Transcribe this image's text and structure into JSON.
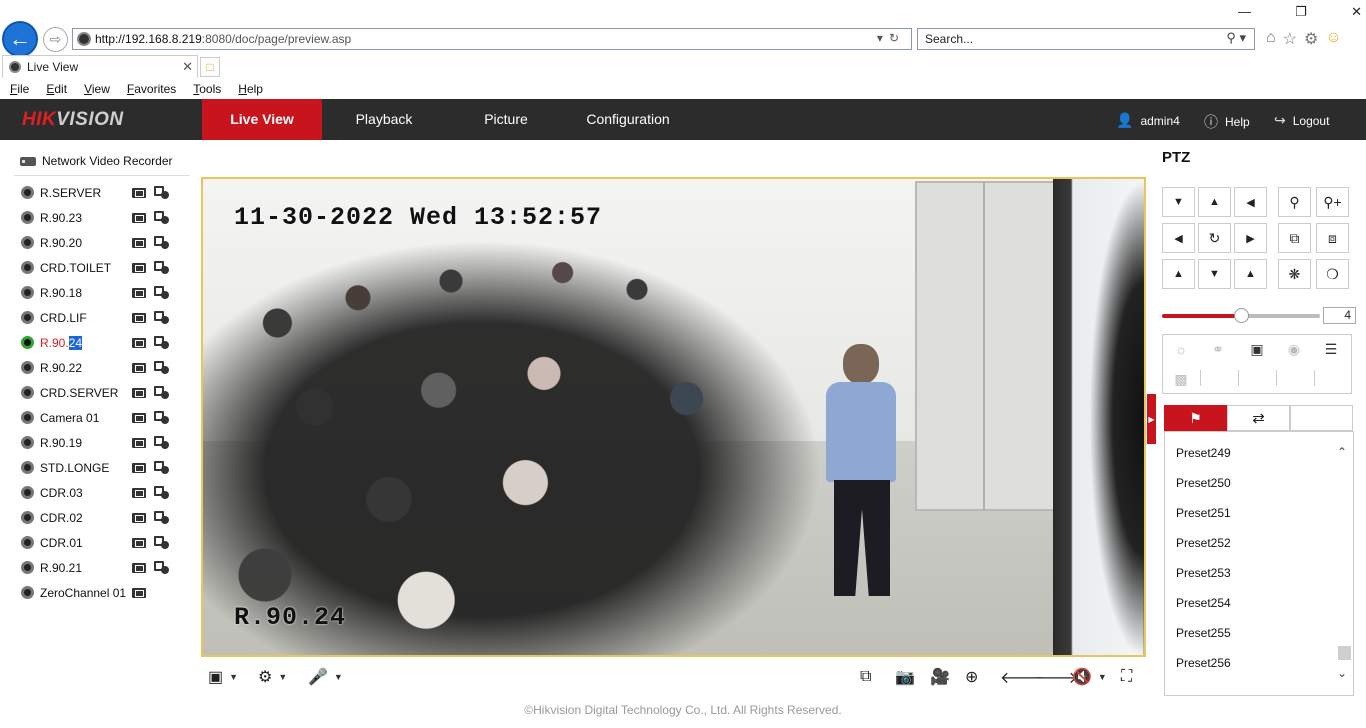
{
  "browser": {
    "url_dark": "http://192.168.8.219",
    "url_rest": ":8080/doc/page/preview.asp",
    "search_placeholder": "Search...",
    "tab_title": "Live View",
    "menu": [
      "File",
      "Edit",
      "View",
      "Favorites",
      "Tools",
      "Help"
    ]
  },
  "app": {
    "logo_hik": "HIK",
    "logo_vision": "VISION",
    "tabs": [
      "Live View",
      "Playback",
      "Picture",
      "Configuration"
    ],
    "user": "admin4",
    "help": "Help",
    "logout": "Logout",
    "accent": "#c8151d"
  },
  "tree": {
    "root": "Network Video Recorder",
    "cameras": [
      {
        "name": "R.SERVER"
      },
      {
        "name": "R.90.23"
      },
      {
        "name": "R.90.20"
      },
      {
        "name": "CRD.TOILET"
      },
      {
        "name": "R.90.18"
      },
      {
        "name": "CRD.LIF"
      },
      {
        "name_red": "R.90.",
        "name_sel": "24",
        "active": true
      },
      {
        "name": "R.90.22"
      },
      {
        "name": "CRD.SERVER"
      },
      {
        "name": "Camera 01"
      },
      {
        "name": "R.90.19"
      },
      {
        "name": "STD.LONGE"
      },
      {
        "name": "CDR.03"
      },
      {
        "name": "CDR.02"
      },
      {
        "name": "CDR.01"
      },
      {
        "name": "R.90.21"
      },
      {
        "name": "ZeroChannel 01"
      }
    ]
  },
  "video": {
    "timestamp": "11-30-2022 Wed 13:52:57",
    "label": "R.90.24"
  },
  "ptz": {
    "title": "PTZ",
    "speed": "4",
    "speed_fraction": 0.5,
    "presets": [
      "Preset249",
      "Preset250",
      "Preset251",
      "Preset252",
      "Preset253",
      "Preset254",
      "Preset255",
      "Preset256"
    ]
  },
  "footer": {
    "copyright": "©Hikvision Digital Technology Co., Ltd. All Rights Reserved."
  }
}
